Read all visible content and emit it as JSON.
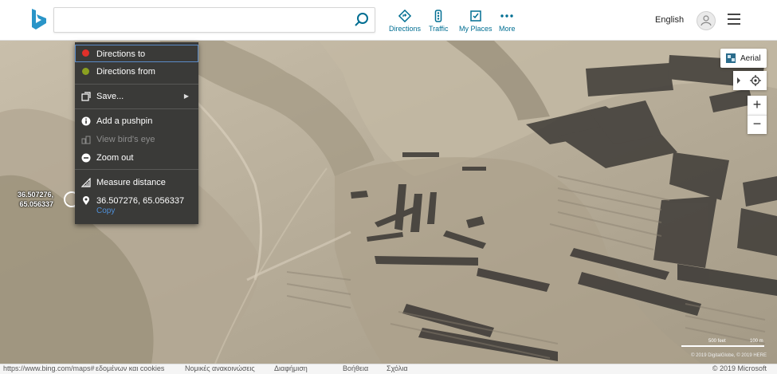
{
  "header": {
    "search_placeholder": "",
    "nav": [
      {
        "label": "Directions",
        "icon": "directions-icon"
      },
      {
        "label": "Traffic",
        "icon": "traffic-icon"
      },
      {
        "label": "My Places",
        "icon": "my-places-icon"
      },
      {
        "label": "More",
        "icon": "more-icon"
      }
    ],
    "language": "English"
  },
  "context_menu": {
    "items": [
      {
        "label": "Directions to",
        "icon": "red-dot-icon",
        "color": "#e0302a"
      },
      {
        "label": "Directions from",
        "icon": "green-dot-icon",
        "color": "#8aa020"
      },
      {
        "label": "Save...",
        "icon": "save-icon"
      },
      {
        "label": "Add a pushpin",
        "icon": "info-icon"
      },
      {
        "label": "View bird's eye",
        "icon": "birds-eye-icon"
      },
      {
        "label": "Zoom out",
        "icon": "zoom-out-icon"
      },
      {
        "label": "Measure distance",
        "icon": "ruler-icon"
      },
      {
        "label": "36.507276, 65.056337",
        "icon": "location-pin-icon"
      }
    ],
    "copy_label": "Copy"
  },
  "map": {
    "coord_label_line1": "36.507276,",
    "coord_label_line2": "65.056337",
    "style_button": "Aerial",
    "zoom_in": "+",
    "zoom_out": "−",
    "scale_feet": "500 feet",
    "scale_meters": "100 m",
    "credits": "© 2019 DigitalGlobe, © 2019 HERE"
  },
  "footer": {
    "url": "https://www.bing.com/maps#",
    "links": [
      "εδομένων και cookies",
      "Νομικές ανακοινώσεις",
      "Διαφήμιση",
      "Βοήθεια",
      "Σχόλια"
    ],
    "copyright": "© 2019 Microsoft"
  },
  "colors": {
    "accent": "#006e92",
    "menu_bg": "#3a3a38",
    "highlight_border": "#5b8bc7"
  }
}
